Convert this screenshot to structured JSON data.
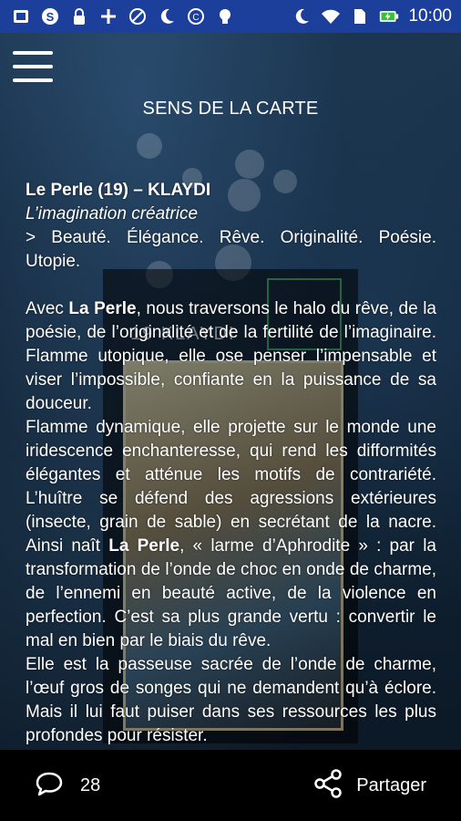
{
  "status_bar": {
    "time": "10:00",
    "icons": [
      "screen-icon",
      "skype-icon",
      "lock-icon",
      "fan-icon",
      "blocked-icon",
      "moon-icon",
      "data-saver-icon",
      "bulb-icon",
      "moon-icon",
      "wifi-icon",
      "sim-icon",
      "battery-icon"
    ]
  },
  "header": {
    "title": "SENS DE LA CARTE"
  },
  "card_image": {
    "label": "19 KLAYDI"
  },
  "content": {
    "title_name": "Le Perle (19) – KLAYDI",
    "subtitle": "L’imagination créatrice",
    "keywords": "> Beauté. Élégance. Rêve. Originalité. Poésie. Utopie.",
    "p1_a": "Avec ",
    "p1_b": "La Perle",
    "p1_c": ", nous traversons le halo du rêve, de la poésie, de l’originalité et de la fertilité de l’imaginaire. Flamme utopique, elle ose penser l’impensable et viser l’impossible, confiante en la puissance de sa douceur.",
    "p2_a": "Flamme dynamique, elle projette sur le monde une iridescence enchanteresse, qui rend les difformités élégantes et atténue les motifs de contrariété. L’huître se défend des agressions extérieures (insecte, grain de sable) en secrétant de la nacre. Ainsi naît ",
    "p2_b": "La Perle",
    "p2_c": ", « larme d’Aphrodite » : par la transformation de l’onde de choc en onde de charme, de l’ennemi en beauté active, de la violence en perfection. C’est sa plus grande vertu : convertir le mal en bien par le biais du rêve.",
    "p3": "Elle est la passeuse sacrée de l’onde de charme, l’œuf gros de songes qui ne demandent qu’à éclore. Mais il lui faut puiser dans ses ressources les plus profondes pour résister."
  },
  "bottom_bar": {
    "comment_count": "28",
    "share_label": "Partager"
  }
}
